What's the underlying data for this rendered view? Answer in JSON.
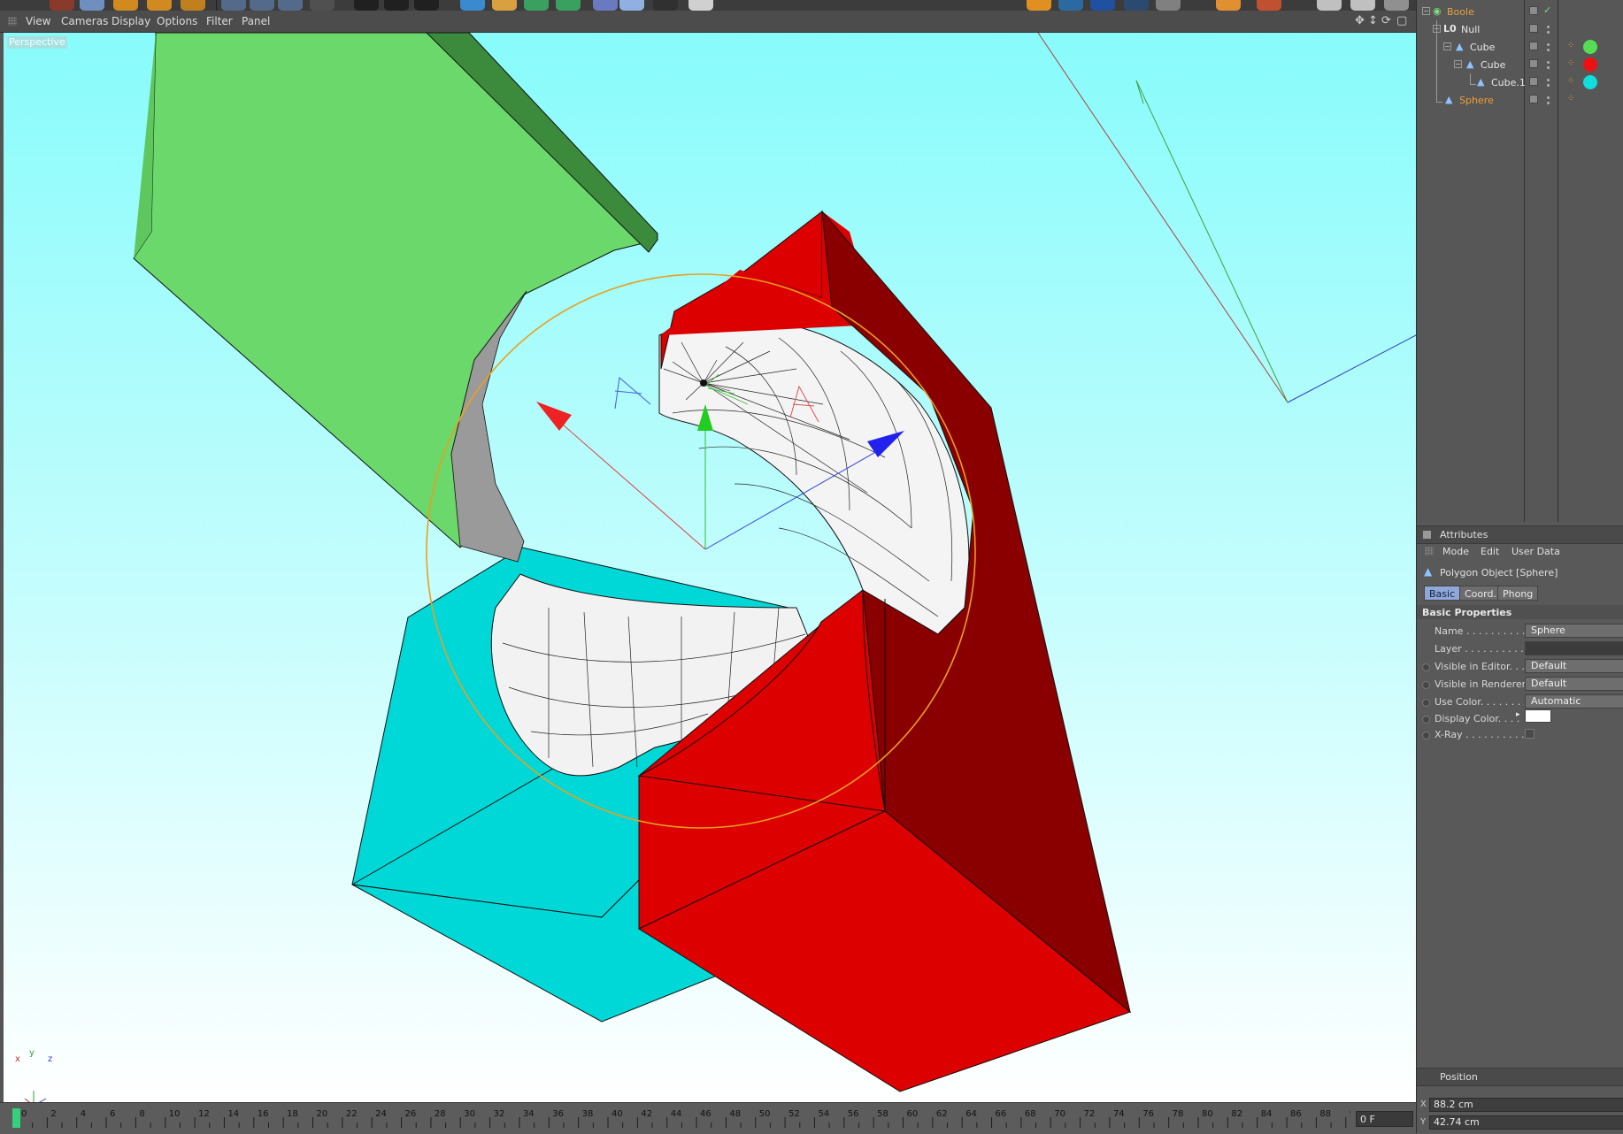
{
  "viewport": {
    "menu": [
      "View",
      "Cameras",
      "Display",
      "Options",
      "Filter",
      "Panel"
    ],
    "camera_label": "Perspective",
    "axis_labels": {
      "x": "x",
      "y": "y",
      "z": "z"
    }
  },
  "timeline": {
    "ticks": [
      "0",
      "2",
      "4",
      "6",
      "8",
      "10",
      "12",
      "14",
      "16",
      "18",
      "20",
      "22",
      "24",
      "26",
      "28",
      "30",
      "32",
      "34",
      "36",
      "38",
      "40",
      "42",
      "44",
      "46",
      "48",
      "50",
      "52",
      "54",
      "56",
      "58",
      "60",
      "62",
      "64",
      "66",
      "68",
      "70",
      "72",
      "74",
      "76",
      "78",
      "80",
      "82",
      "84",
      "86",
      "88",
      "90"
    ],
    "current_frame": "0 F"
  },
  "object_manager": {
    "items": [
      {
        "name": "Boole",
        "icon": "boole-icon",
        "tag_color": ""
      },
      {
        "name": "Null",
        "icon": "null-icon",
        "tag_color": ""
      },
      {
        "name": "Cube",
        "icon": "polygon-icon",
        "tag_color": "#55dd55"
      },
      {
        "name": "Cube",
        "icon": "polygon-icon",
        "tag_color": "#ee1111"
      },
      {
        "name": "Cube.1",
        "icon": "polygon-icon",
        "tag_color": "#11dddd"
      },
      {
        "name": "Sphere",
        "icon": "polygon-icon",
        "tag_color": ""
      }
    ]
  },
  "attributes": {
    "title": "Attributes",
    "menu": [
      "Mode",
      "Edit",
      "User Data"
    ],
    "object_type": "Polygon Object [Sphere]",
    "tabs": [
      "Basic",
      "Coord.",
      "Phong"
    ],
    "active_tab": "Basic",
    "section": "Basic Properties",
    "properties": [
      {
        "label": "Name . . . . . . . . . . . .",
        "value": "Sphere"
      },
      {
        "label": "Layer . . . . . . . . . . .",
        "value": ""
      },
      {
        "label": "Visible in Editor. . .",
        "value": "Default"
      },
      {
        "label": "Visible in Renderer",
        "value": "Default"
      },
      {
        "label": "Use Color. . . . . . . . .",
        "value": "Automatic"
      },
      {
        "label": "Display Color. . . .",
        "value": "#ffffff"
      },
      {
        "label": "X-Ray . . . . . . . . . . .",
        "value": ""
      }
    ],
    "position_section": "Position",
    "position": {
      "x_label": "X",
      "x": "88.2 cm",
      "y_label": "Y",
      "y": "42.74 cm"
    }
  }
}
